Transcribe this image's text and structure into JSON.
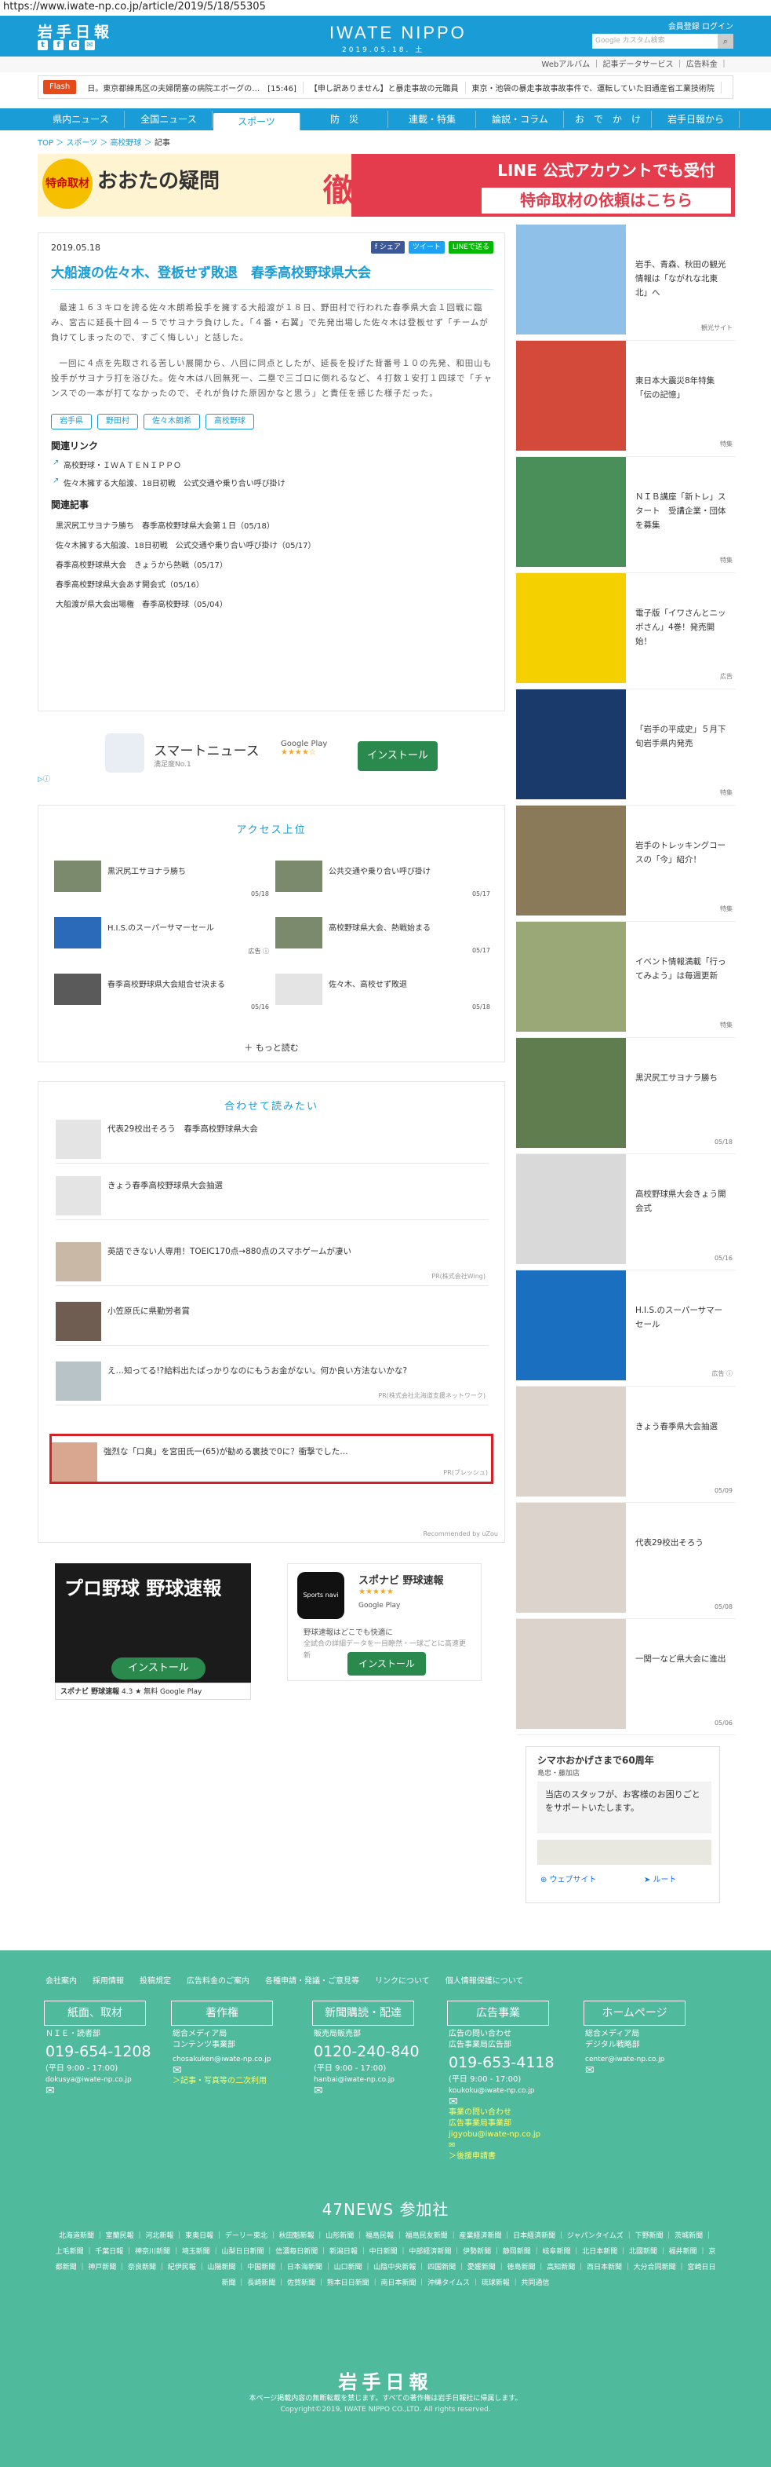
{
  "url": "https://www.iwate-np.co.jp/article/2019/5/18/55305",
  "header": {
    "logo": "岩手日報",
    "social": [
      "t",
      "f",
      "G",
      "✉"
    ],
    "brand": "IWATE NIPPO",
    "date": "2019.05.18. 土",
    "links": "会員登録  ログイン",
    "search_placeholder": "Google カスタム検索",
    "sublinks": "Webアルバム ｜ 記事データサービス ｜ 広告料金 ｜"
  },
  "flash": {
    "label": "Flash",
    "items": [
      "日。東京都練馬区の夫婦閉塞の病院エボーグの…　[15:46]",
      "【申し訳ありません】と暴走事故の元職員",
      "東京・池袋の暴走事故事故事件で、運転していた旧通産省工業技術院"
    ]
  },
  "nav": [
    "県内ニュース",
    "全国ニュース",
    "スポーツ",
    "防　災",
    "連載・特集",
    "論説・コラム",
    "お　で　か　け",
    "岩手日報から"
  ],
  "breadcrumb": [
    "TOP",
    "スポーツ",
    "高校野球",
    "記事"
  ],
  "banner": {
    "mark": "特命取材",
    "question": "おおたの疑問",
    "big": "徹底解明",
    "line1": "LINE 公式アカウントでも受付",
    "line2": "特命取材の依頼はこちら"
  },
  "article": {
    "date": "2019.05.18",
    "shares": [
      "f シェア",
      "ツイート",
      "LINEで送る"
    ],
    "title": "大船渡の佐々木、登板せず敗退　春季高校野球県大会",
    "p1": "最速１６３キロを誇る佐々木朗希投手を擁する大船渡が１８日、野田村で行われた春季県大会１回戦に臨み、宮古に延長十回４－５でサヨナラ負けした。「４番・右翼」で先発出場した佐々木は登板せず「チームが負けてしまったので、すごく悔しい」と話した。",
    "p2": "一回に４点を先取される苦しい展開から、八回に同点としたが、延長を投げた背番号１０の先発、和田山も投手がサヨナラ打を浴びた。佐々木は八回無死一、二塁で三ゴロに倒れるなど、４打数１安打１四球で「チャンスでの一本が打てなかったので、それが負けた原因かなと思う」と責任を感じた様子だった。",
    "tags": [
      "岩手県",
      "野田村",
      "佐々木朗希",
      "高校野球"
    ],
    "related_h": "関連リンク",
    "related": [
      "高校野球・ＩＷＡＴＥＮＩＰＰＯ",
      "佐々木擁する大船渡、18日初戦　公式交通や乗り合い呼び掛け"
    ],
    "articles_h": "関連記事",
    "articles": [
      "黒沢尻工サヨナラ勝ち　春季高校野球県大会第１日（05/18）",
      "佐々木擁する大船渡、18日初戦　公式交通や乗り合い呼び掛け（05/17）",
      "春季高校野球県大会　きょうから熱戦（05/17）",
      "春季高校野球県大会あす開会式（05/16）",
      "大船渡が県大会出場権　春季高校野球（05/04）"
    ]
  },
  "smartnews": {
    "name": "スマートニュース",
    "sub": "満足度No.1",
    "gp": "Google Play",
    "stars": "★★★★☆",
    "install": "インストール",
    "adchip": "▷ⓘ"
  },
  "ranking": {
    "title": "アクセス上位",
    "items": [
      {
        "t": "黒沢尻工サヨナラ勝ち",
        "d": "05/18"
      },
      {
        "t": "公共交通や乗り合い呼び掛け",
        "d": "05/17"
      },
      {
        "t": "H.I.S.のスーパーサマーセール",
        "d": "広告 ⓘ"
      },
      {
        "t": "高校野球県大会、熱戦始まる",
        "d": "05/17"
      },
      {
        "t": "春季高校野球県大会組合せ決まる",
        "d": "05/16"
      },
      {
        "t": "佐々木、高校せず敗退",
        "d": "05/18"
      }
    ],
    "more": "＋ もっと読む"
  },
  "reco": {
    "title": "合わせて読みたい",
    "items": [
      {
        "t": "代表29校出そろう　春季高校野球県大会",
        "pr": ""
      },
      {
        "t": "きょう春季高校野球県大会抽選",
        "pr": ""
      },
      {
        "t": "英語できない人専用！TOEIC170点→880点のスマホゲームが凄い",
        "pr": "PR(株式会社Wing)"
      },
      {
        "t": "小笠原氏に県勤労者賞",
        "pr": ""
      },
      {
        "t": "え…知ってる!?給料出たばっかりなのにもうお金がない。何か良い方法ないかな?",
        "pr": "PR(株式会社北海道支援ネットワーク)"
      },
      {
        "t": "強烈な「口臭」を宮田氏一(65)が勧める裏技で0に？衝撃でした…",
        "pr": "PR(ブレッシュ)"
      }
    ],
    "foot": "Recommended by uZou"
  },
  "app_ad": {
    "banner_text": "プロ野球\n野球速報",
    "install": "インストール",
    "app_name": "スポナビ 野球速報",
    "rating": "4.3 ★ 無料",
    "gp": "Google Play",
    "name2": "スポナビ 野球速報",
    "stars": "★★★★★",
    "desc": "野球速報はどこでも快適に",
    "desc2": "全試合の詳細データを一目瞭然・一球ごとに高速更新",
    "install2": "インストール",
    "icon": "Sports navi"
  },
  "sidebar": [
    {
      "t": "岩手、青森、秋田の観光情報は「ながれな北東北」へ",
      "l": "観光サイト"
    },
    {
      "t": "東日本大震災8年特集「伝の記憶」",
      "l": "特集"
    },
    {
      "t": "ＮＩＢ講座「新トレ」スタート　受講企業・団体を募集",
      "l": "特集"
    },
    {
      "t": "電子版「イワさんとニッポさん」4巻！発売開始！",
      "l": "広告"
    },
    {
      "t": "「岩手の平成史」５月下旬岩手県内発売",
      "l": "特集"
    },
    {
      "t": "岩手のトレッキングコースの「今」紹介！",
      "l": "特集"
    },
    {
      "t": "イベント情報満載「行ってみよう」は毎週更新",
      "l": "特集"
    },
    {
      "t": "黒沢尻工サヨナラ勝ち",
      "l": "05/18"
    },
    {
      "t": "高校野球県大会きょう開会式",
      "l": "05/16"
    },
    {
      "t": "H.I.S.のスーパーサマーセール",
      "l": "広告 ⓘ"
    },
    {
      "t": "きょう春季県大会抽選",
      "l": "05/09"
    },
    {
      "t": "代表29校出そろう",
      "l": "05/08"
    },
    {
      "t": "一関一など県大会に進出",
      "l": "05/06"
    }
  ],
  "map_ad": {
    "t1": "シマホおかげさまで60周年",
    "t2": "島忠・藤加店",
    "box": "当店のスタッフが、お客様のお困りごとをサポートいたします。",
    "b1": "⊕ ウェブサイト",
    "b2": "➤ ルート"
  },
  "footer": {
    "nav": [
      "会社案内",
      "採用情報",
      "投稿規定",
      "広告料金のご案内",
      "各種申請・発議・ご意見等",
      "リンクについて",
      "個人情報保護について"
    ],
    "cols": [
      {
        "h": "紙面、取材",
        "sub": "ＮＩＥ・読者部",
        "ph": "019-654-1208",
        "hours": "(平日 9:00 - 17:00)",
        "em": "dokusya@iwate-np.co.jp",
        "mi": "✉",
        "ln": ""
      },
      {
        "h": "著作権",
        "sub": "総合メディア局\nコンテンツ事業部",
        "ph": "",
        "hours": "",
        "em": "chosakuken@iwate-np.co.jp",
        "mi": "✉",
        "ln": "＞記事・写真等の二次利用"
      },
      {
        "h": "新聞購読・配達",
        "sub": "販売局販売部",
        "ph": "0120-240-840",
        "hours": "(平日 9:00 - 17:00)",
        "em": "hanbai@iwate-np.co.jp",
        "mi": "✉",
        "ln": ""
      },
      {
        "h": "広告事業",
        "sub": "広告の問い合わせ\n広告事業局広告部",
        "ph": "019-653-4118",
        "hours": "(平日 9:00 - 17:00)",
        "em": "koukoku@iwate-np.co.jp",
        "mi": "✉",
        "ln": "事業の問い合わせ\n広告事業局事業部\njigyobu@iwate-np.co.jp\n✉\n＞後援申請書"
      },
      {
        "h": "ホームページ",
        "sub": "総合メディア局\nデジタル戦略部",
        "ph": "",
        "hours": "",
        "em": "center@iwate-np.co.jp",
        "mi": "✉",
        "ln": ""
      }
    ],
    "n47": "47NEWS 参加社",
    "n47list": "北海道新聞 ｜ 室蘭民報 ｜ 河北新報 ｜ 東奥日報 ｜ デーリー東北 ｜ 秋田魁新報 ｜ 山形新聞 ｜ 福島民報 ｜ 福島民友新聞 ｜ 産業経済新聞 ｜ 日本経済新聞 ｜ ジャパンタイムズ ｜ 下野新聞 ｜ 茨城新聞 ｜ 上毛新聞 ｜ 千葉日報 ｜ 神奈川新聞 ｜ 埼玉新聞 ｜ 山梨日日新聞 ｜ 信濃毎日新聞 ｜ 新潟日報 ｜ 中日新聞 ｜ 中部経済新聞 ｜ 伊勢新聞 ｜ 静岡新聞 ｜ 岐阜新聞 ｜ 北日本新聞 ｜ 北國新聞 ｜ 福井新聞 ｜ 京都新聞 ｜ 神戸新聞 ｜ 奈良新聞 ｜ 紀伊民報 ｜ 山陽新聞 ｜ 中国新聞 ｜ 日本海新聞 ｜ 山口新聞 ｜ 山陰中央新報 ｜ 四国新聞 ｜ 愛媛新聞 ｜ 徳島新聞 ｜ 高知新聞 ｜ 西日本新聞 ｜ 大分合同新聞 ｜ 宮崎日日新聞 ｜ 長崎新聞 ｜ 佐賀新聞 ｜ 熊本日日新聞 ｜ 南日本新聞 ｜ 沖縄タイムス ｜ 琉球新報 ｜ 共同通信",
    "logo": "岩手日報",
    "copy1": "本ページ掲載内容の無断転載を禁じます。すべての著作権は岩手日報社に帰属します。",
    "copy2": "Copyright©2019, IWATE NIPPO CO.,LTD. All rights reserved."
  }
}
